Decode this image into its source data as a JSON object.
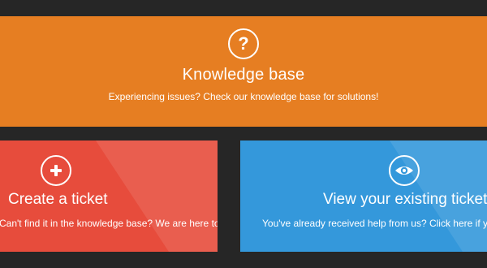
{
  "knowledge_base": {
    "icon": "question-mark-icon",
    "icon_glyph": "?",
    "title": "Knowledge base",
    "subtitle": "Experiencing issues? Check our knowledge base for solutions!"
  },
  "create_ticket": {
    "icon": "plus-icon",
    "title": "Create a ticket",
    "subtitle": "Can't find it in the knowledge base? We are here to help you!"
  },
  "view_tickets": {
    "icon": "eye-icon",
    "title": "View your existing tickets",
    "subtitle": "You've already received help from us? Click here if you want to see your tickets!"
  },
  "colors": {
    "background": "#262626",
    "knowledge_base": "#e67e22",
    "create_ticket": "#e74c3c",
    "view_tickets": "#3498db"
  }
}
